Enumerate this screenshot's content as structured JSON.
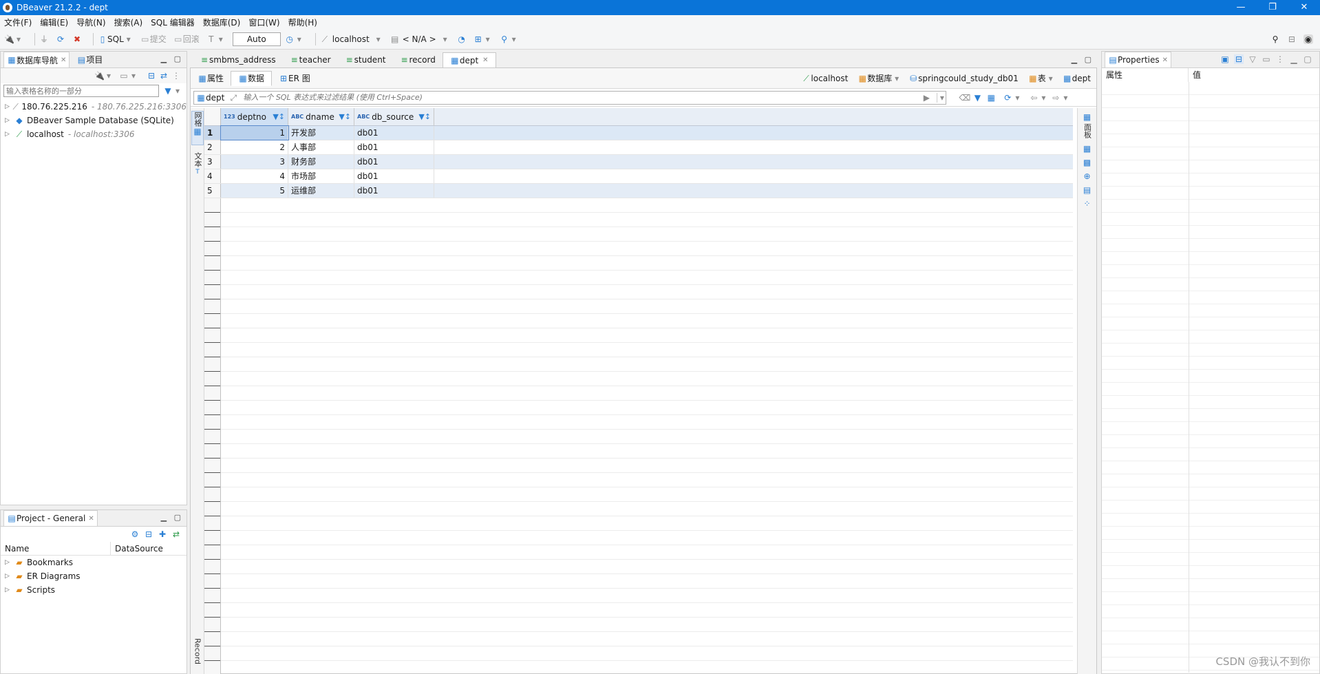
{
  "window": {
    "title": "DBeaver 21.2.2 - dept",
    "min": "—",
    "restore": "❐",
    "close": "✕"
  },
  "menu": [
    "文件(F)",
    "编辑(E)",
    "导航(N)",
    "搜索(A)",
    "SQL 编辑器",
    "数据库(D)",
    "窗口(W)",
    "帮助(H)"
  ],
  "toolbar": {
    "sql": "SQL",
    "commit": "提交",
    "rollback": "回滚",
    "auto": "Auto",
    "connection": "localhost",
    "schema": "< N/A >"
  },
  "nav_panel": {
    "tabs": [
      {
        "label": "数据库导航"
      },
      {
        "label": "项目"
      }
    ],
    "filter_placeholder": "输入表格名称的一部分",
    "items": [
      {
        "label": "180.76.225.216",
        "sub": "- 180.76.225.216:3306"
      },
      {
        "label": "DBeaver Sample Database (SQLite)",
        "sub": ""
      },
      {
        "label": "localhost",
        "sub": "- localhost:3306"
      }
    ]
  },
  "project_panel": {
    "tab": "Project - General",
    "columns": [
      "Name",
      "DataSource"
    ],
    "items": [
      {
        "label": "Bookmarks"
      },
      {
        "label": "ER Diagrams"
      },
      {
        "label": "Scripts"
      }
    ]
  },
  "editor": {
    "tabs": [
      {
        "label": "smbms_address"
      },
      {
        "label": "teacher"
      },
      {
        "label": "student"
      },
      {
        "label": "record"
      },
      {
        "label": "dept"
      }
    ],
    "subtabs": [
      "属性",
      "数据",
      "ER 图"
    ],
    "breadcrumb": [
      "localhost",
      "数据库",
      "springcould_study_db01",
      "表",
      "dept"
    ],
    "filter_table": "dept",
    "filter_placeholder": "输入一个 SQL 表达式来过滤结果 (使用 Ctrl+Space)",
    "side_labels": {
      "grid": "网格",
      "text": "文本",
      "record": "Record",
      "panels": "面板"
    }
  },
  "grid": {
    "columns": [
      {
        "name": "deptno",
        "type": "123"
      },
      {
        "name": "dname",
        "type": "ABC"
      },
      {
        "name": "db_source",
        "type": "ABC"
      }
    ],
    "rows": [
      {
        "n": "1",
        "deptno": "1",
        "dname": "开发部",
        "db_source": "db01"
      },
      {
        "n": "2",
        "deptno": "2",
        "dname": "人事部",
        "db_source": "db01"
      },
      {
        "n": "3",
        "deptno": "3",
        "dname": "财务部",
        "db_source": "db01"
      },
      {
        "n": "4",
        "deptno": "4",
        "dname": "市场部",
        "db_source": "db01"
      },
      {
        "n": "5",
        "deptno": "5",
        "dname": "运维部",
        "db_source": "db01"
      }
    ]
  },
  "properties": {
    "tab": "Properties",
    "col_attr": "属性",
    "col_value": "值"
  },
  "watermark": "CSDN @我认不到你"
}
